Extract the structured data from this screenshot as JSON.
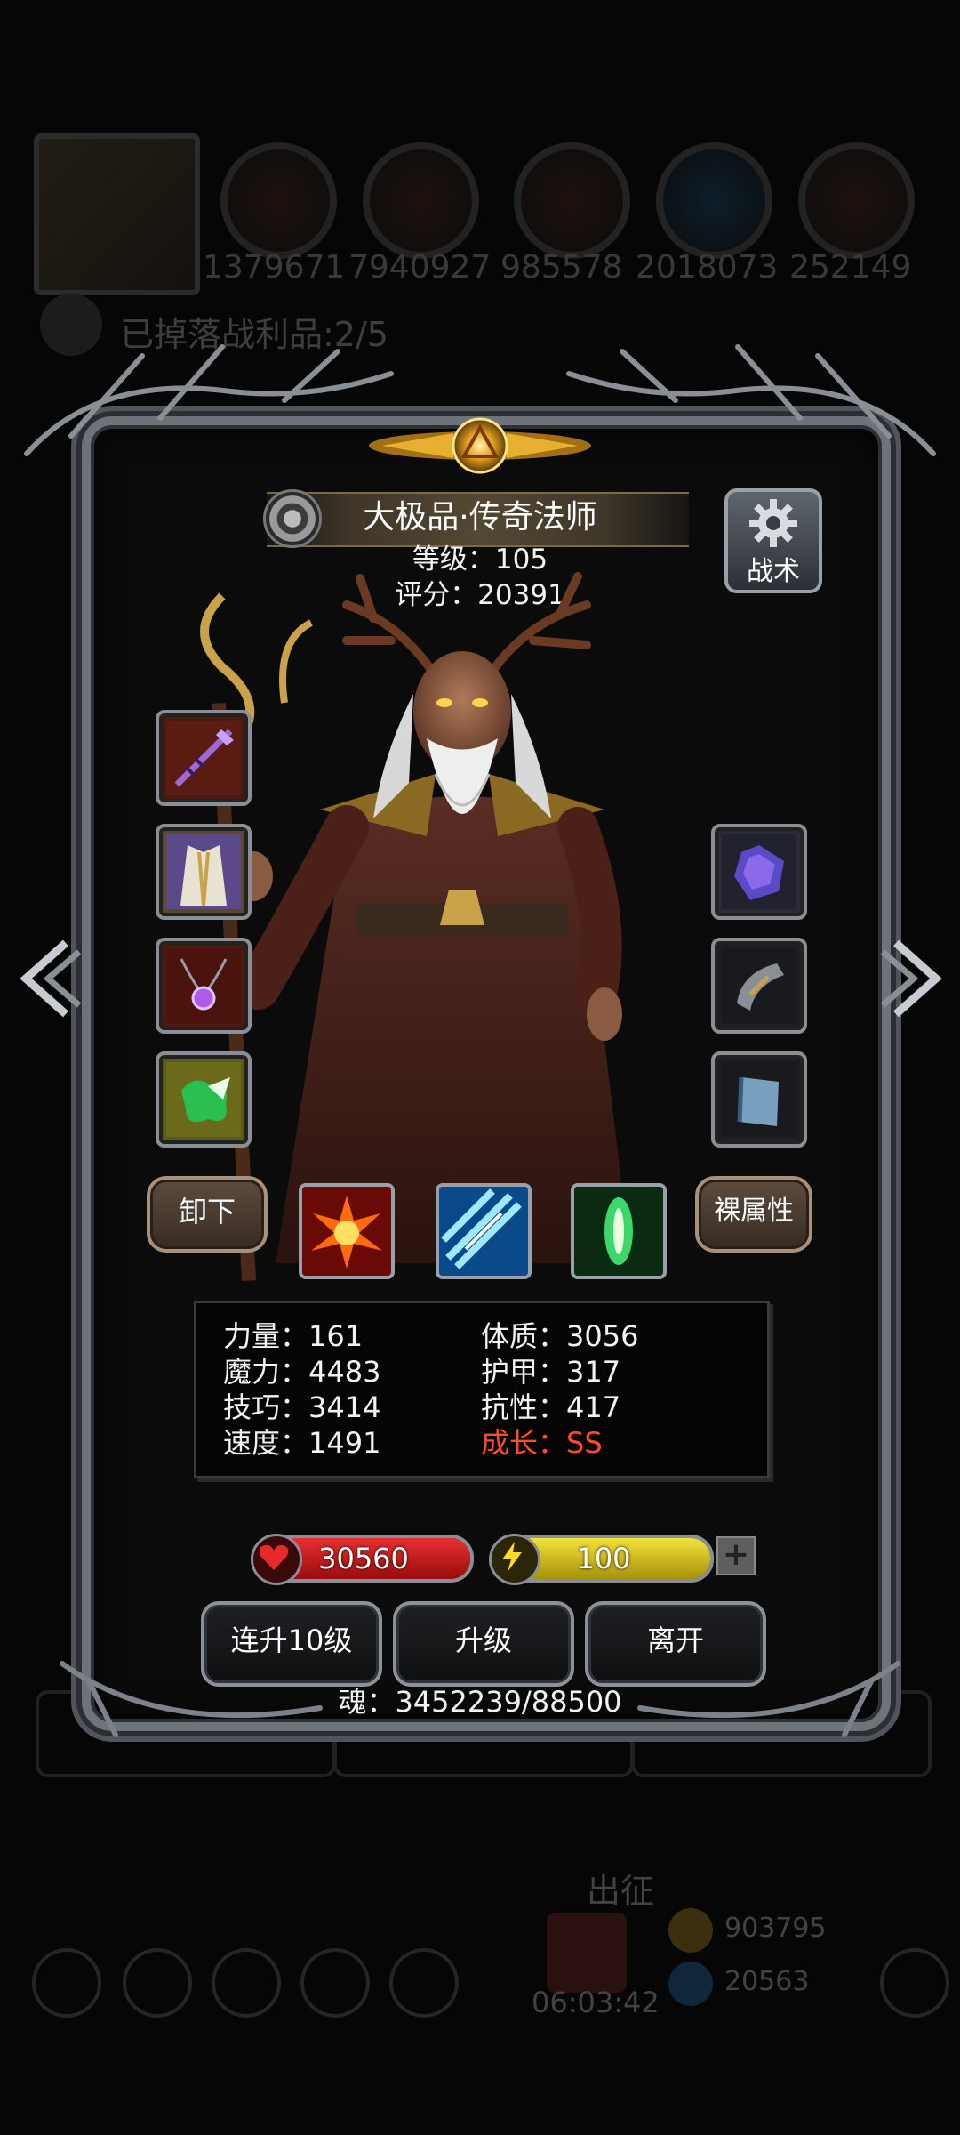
{
  "background_hud": {
    "resources": [
      "1379671",
      "7940927",
      "985578",
      "2018073",
      "252149"
    ],
    "loot_text": "已掉落战利品:2/5",
    "tabs": [
      "",
      "",
      ""
    ],
    "depart_label": "出征",
    "timer": "06:03:42",
    "gold": "903795",
    "gems": "20563"
  },
  "hero": {
    "title": "大极品·传奇法师",
    "level_text": "等级：105",
    "score_text": "评分：20391"
  },
  "tactic_button": {
    "label": "战术",
    "icon": "gear-icon"
  },
  "equipment": {
    "left": [
      "staff-icon",
      "robe-icon",
      "amulet-icon",
      "rune-icon"
    ],
    "right": [
      "orb-icon",
      "bracer-icon",
      "book-icon"
    ]
  },
  "buttons": {
    "unequip": "卸下",
    "naked_attributes": "裸属性",
    "multi_upgrade": "连升10级",
    "upgrade": "升级",
    "leave": "离开"
  },
  "skills": [
    "fire-burst-icon",
    "ice-shard-icon",
    "nature-heal-icon"
  ],
  "stats": {
    "strength": "力量：161",
    "magic": "魔力：4483",
    "skill": "技巧：3414",
    "speed": "速度：1491",
    "constitution": "体质：3056",
    "armor": "护甲：317",
    "resistance": "抗性：417",
    "growth": "成长：SS"
  },
  "bars": {
    "hp": {
      "value": "30560",
      "fill": 1.0,
      "color": "#c81a1a"
    },
    "energy": {
      "value": "100",
      "fill": 1.0,
      "color": "#d8c21a"
    }
  },
  "plus_label": "+",
  "soul_text": "魂：3452239/88500",
  "colors": {
    "growth": "#ff4b2b",
    "frame": "#6e737a",
    "accent_gold": "#c9a24a"
  }
}
